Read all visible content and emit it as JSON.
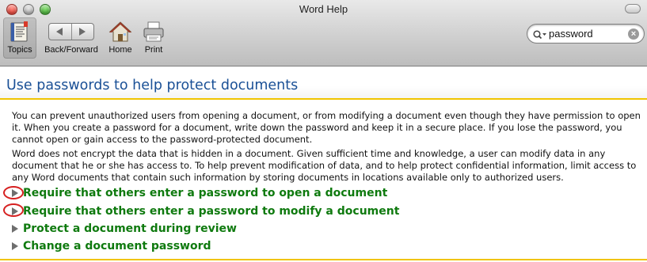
{
  "window": {
    "title": "Word Help"
  },
  "toolbar": {
    "topics_label": "Topics",
    "backforward_label": "Back/Forward",
    "home_label": "Home",
    "print_label": "Print"
  },
  "search": {
    "value": "password"
  },
  "page": {
    "title": "Use passwords to help protect documents",
    "paragraphs": [
      "You can prevent unauthorized users from opening a document, or from modifying a document even though they have permission to open it. When you create a password for a document, write down the password and keep it in a secure place. If you lose the password, you cannot open or gain access to the password-protected document.",
      "Word does not encrypt the data that is hidden in a document. Given sufficient time and knowledge, a user can modify data in any document that he or she has access to. To help prevent modification of data, and to help protect confidential information, limit access to any Word documents that contain such information by storing documents in locations available only to authorized users."
    ],
    "sections": [
      {
        "label": "Require that others enter a password to open a document"
      },
      {
        "label": "Require that others enter a password to modify a document"
      },
      {
        "label": "Protect a document during review"
      },
      {
        "label": "Change a document password"
      }
    ]
  },
  "colors": {
    "title_blue": "#1a5096",
    "link_green": "#0f7a0f",
    "rule_yellow": "#f0c400",
    "annotation_red": "#d62020"
  }
}
